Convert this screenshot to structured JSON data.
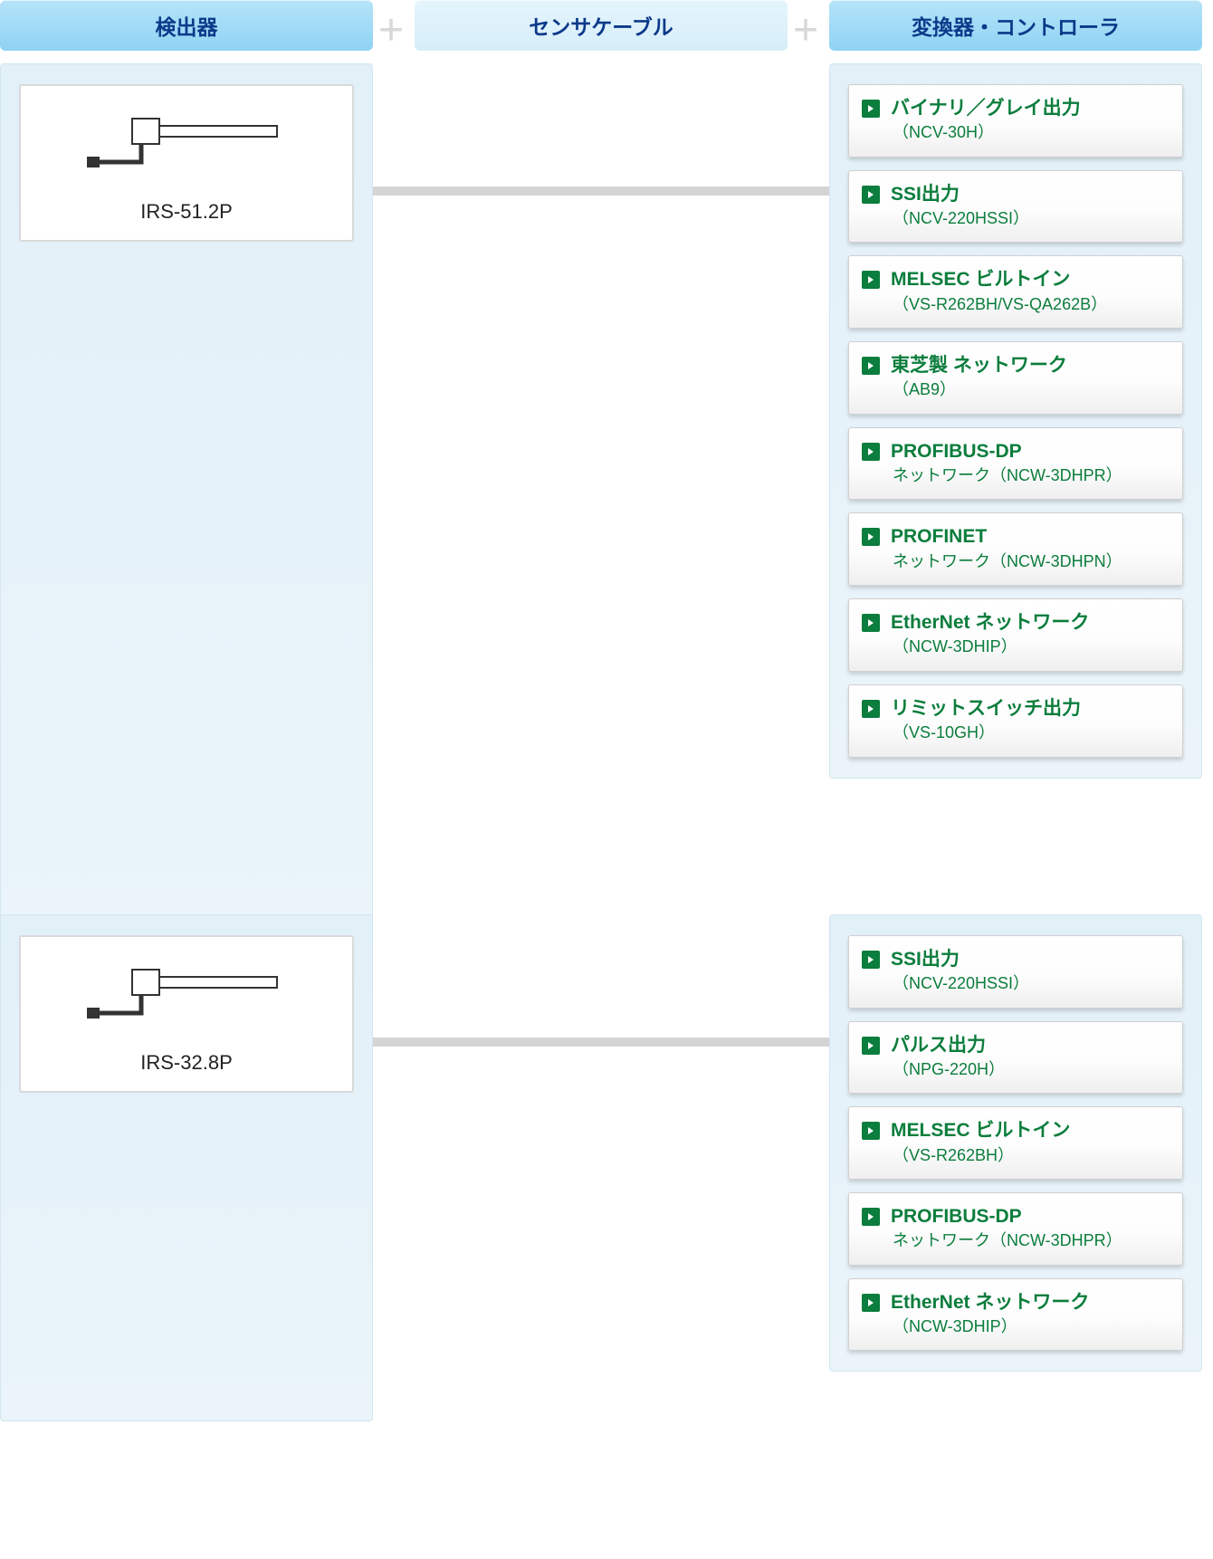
{
  "headers": {
    "detector": "検出器",
    "cable": "センサケーブル",
    "converter": "変換器・コントローラ"
  },
  "groups": [
    {
      "detector": {
        "label": "IRS-51.2P"
      },
      "converters": [
        {
          "title": "バイナリ／グレイ出力",
          "sub": "（NCV-30H）"
        },
        {
          "title": "SSI出力",
          "sub": "（NCV-220HSSI）"
        },
        {
          "title": "MELSEC ビルトイン",
          "sub": "（VS-R262BH/VS-QA262B）"
        },
        {
          "title": "東芝製 ネットワーク",
          "sub": "（AB9）"
        },
        {
          "title": "PROFIBUS-DP",
          "sub": "ネットワーク（NCW-3DHPR）"
        },
        {
          "title": "PROFINET",
          "sub": "ネットワーク（NCW-3DHPN）"
        },
        {
          "title": "EtherNet ネットワーク",
          "sub": "（NCW-3DHIP）"
        },
        {
          "title": "リミットスイッチ出力",
          "sub": "（VS-10GH）"
        }
      ]
    },
    {
      "detector": {
        "label": "IRS-32.8P"
      },
      "converters": [
        {
          "title": "SSI出力",
          "sub": "（NCV-220HSSI）"
        },
        {
          "title": "パルス出力",
          "sub": "（NPG-220H）"
        },
        {
          "title": "MELSEC ビルトイン",
          "sub": "（VS-R262BH）"
        },
        {
          "title": "PROFIBUS-DP",
          "sub": "ネットワーク（NCW-3DHPR）"
        },
        {
          "title": "EtherNet ネットワーク",
          "sub": "（NCW-3DHIP）"
        }
      ]
    }
  ]
}
